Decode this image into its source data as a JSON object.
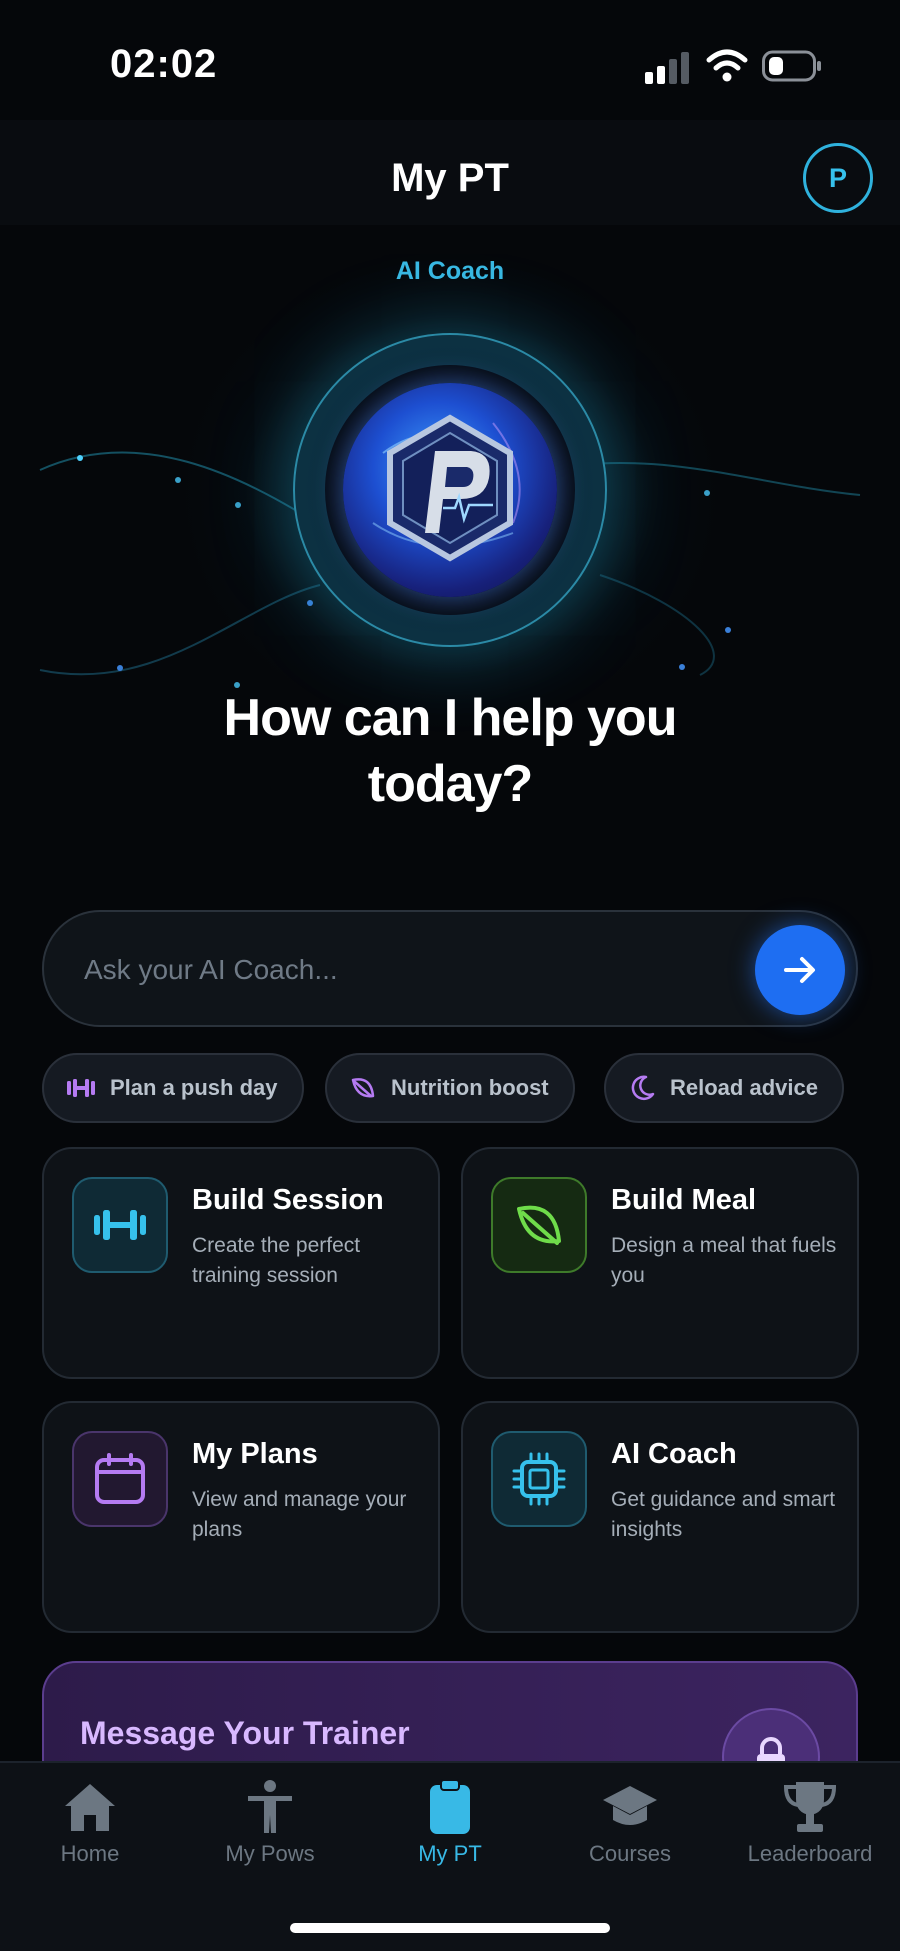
{
  "status_bar": {
    "time": "02:02"
  },
  "header": {
    "title": "My PT",
    "avatar_initial": "P"
  },
  "hero": {
    "label": "AI Coach",
    "heading_line1": "How can I help you",
    "heading_line2": "today?"
  },
  "ask": {
    "placeholder": "Ask your AI Coach...",
    "value": ""
  },
  "chips": [
    {
      "label": "Plan a push day",
      "icon": "dumbbell-icon"
    },
    {
      "label": "Nutrition boost",
      "icon": "leaf-icon"
    },
    {
      "label": "Reload advice",
      "icon": "moon-icon"
    }
  ],
  "cards": [
    {
      "title": "Build Session",
      "description": "Create the perfect training session",
      "icon": "dumbbell-icon",
      "accent": "#36c1ec"
    },
    {
      "title": "Build Meal",
      "description": "Design a meal that fuels you",
      "icon": "leaf-icon",
      "accent": "#6fdc4a"
    },
    {
      "title": "My Plans",
      "description": "View and manage your plans",
      "icon": "calendar-icon",
      "accent": "#b57bf2"
    },
    {
      "title": "AI Coach",
      "description": "Get guidance and smart insights",
      "icon": "chip-icon",
      "accent": "#36c1ec"
    }
  ],
  "trainer": {
    "title": "Message Your Trainer"
  },
  "tabs": [
    {
      "label": "Home",
      "icon": "home-icon",
      "active": false
    },
    {
      "label": "My Pows",
      "icon": "person-icon",
      "active": false
    },
    {
      "label": "My PT",
      "icon": "clipboard-icon",
      "active": true
    },
    {
      "label": "Courses",
      "icon": "graduation-cap-icon",
      "active": false
    },
    {
      "label": "Leaderboard",
      "icon": "trophy-icon",
      "active": false
    }
  ],
  "colors": {
    "accent": "#36c1ec",
    "send_button": "#1e6ef2",
    "background": "#05070a"
  }
}
